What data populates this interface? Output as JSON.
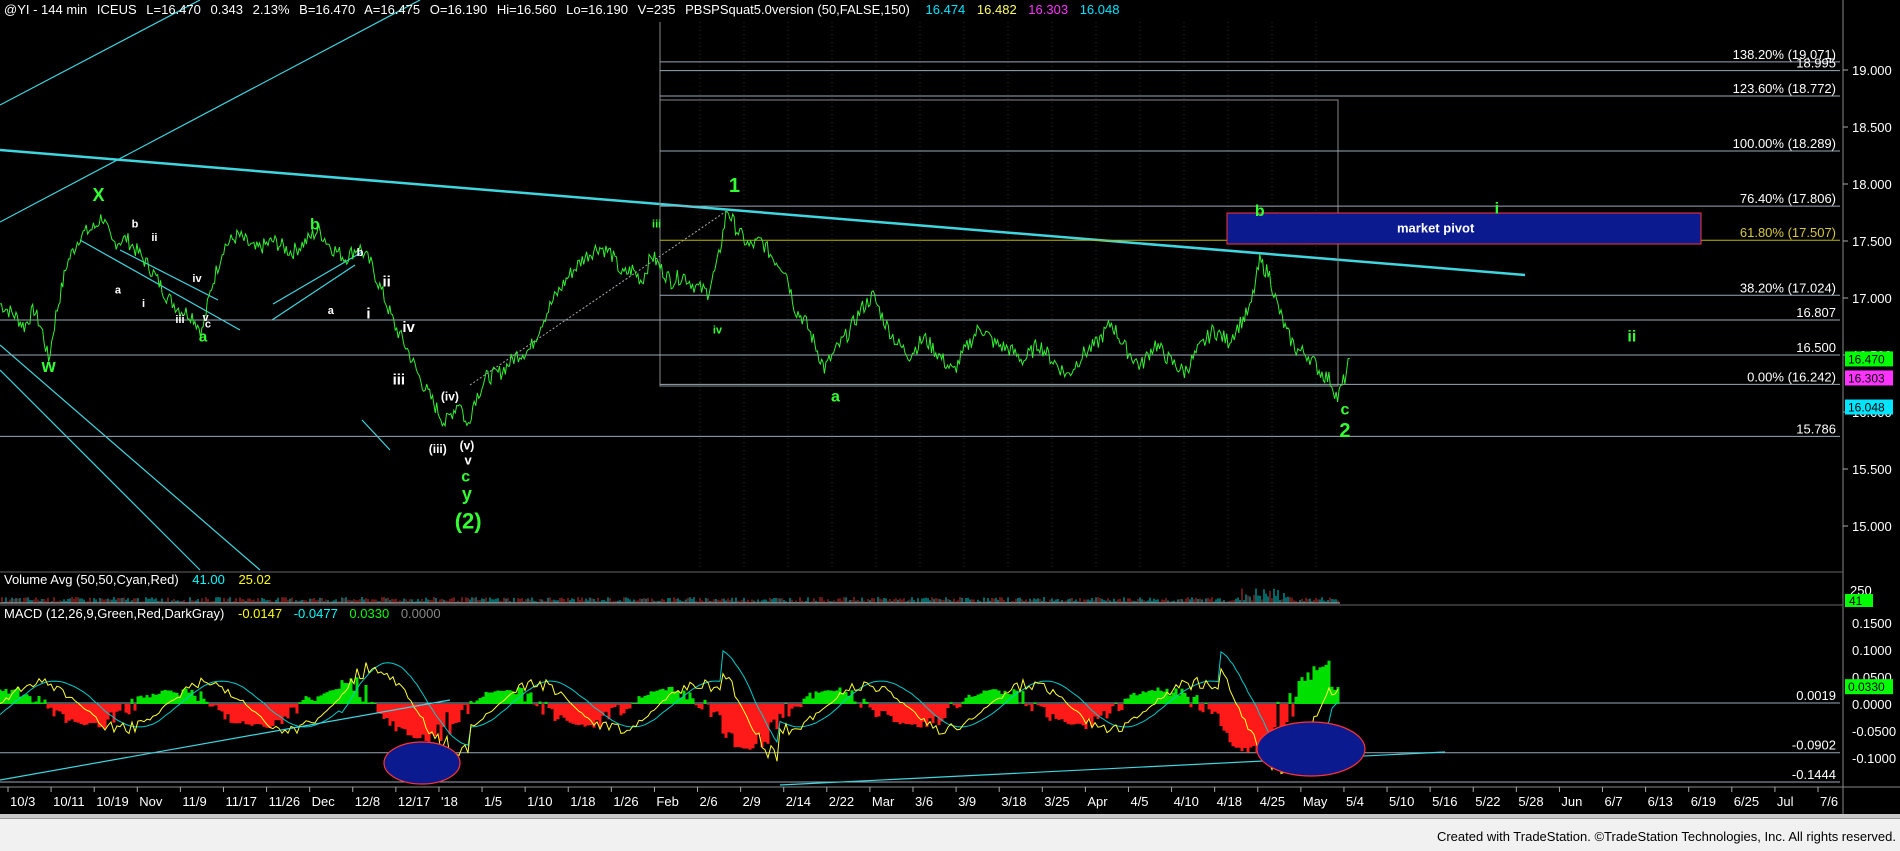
{
  "header": {
    "symbol": "@YI - 144 min",
    "exchange": "ICEUS",
    "last": "L=16.470",
    "change": "0.343",
    "change_pct": "2.13%",
    "bid": "B=16.470",
    "ask": "A=16.475",
    "open": "O=16.190",
    "high": "Hi=16.560",
    "low": "Lo=16.190",
    "volume": "V=235",
    "indicator": "PBSPSquat5.0version (50,FALSE,150)",
    "ind_values": [
      "16.474",
      "16.482",
      "16.303",
      "16.048"
    ],
    "ind_colors": [
      "#00e5ff",
      "#ffff66",
      "#ff33ff",
      "#00e5ff"
    ]
  },
  "volume_panel": {
    "label": "Volume Avg (50,50,Cyan,Red)",
    "values": [
      "41.00",
      "25.02"
    ],
    "value_colors": [
      "#00ffff",
      "#ffff00"
    ],
    "axis_tag": "41",
    "axis_tick": "250"
  },
  "macd_panel": {
    "label": "MACD (12,26,9,Green,Red,DarkGray)",
    "values": [
      "-0.0147",
      "-0.0477",
      "0.0330",
      "0.0000"
    ],
    "value_colors": [
      "#ffff00",
      "#00ffff",
      "#00ff00",
      "#888888"
    ],
    "axis_ticks": [
      "0.1500",
      "0.1000",
      "0.0500",
      "0.0000",
      "-0.0500",
      "-0.1000"
    ],
    "levels": [
      "0.0019",
      "-0.0902",
      "-0.1444"
    ],
    "current_tag": "0.0330"
  },
  "chart_data": {
    "type": "line",
    "price_axis": {
      "ticks": [
        "19.000",
        "18.500",
        "18.000",
        "17.500",
        "17.000",
        "16.500",
        "16.000",
        "15.500",
        "15.000"
      ],
      "ylim": [
        14.6,
        19.45
      ]
    },
    "date_labels": [
      "10/3",
      "10/11",
      "10/19",
      "Nov",
      "11/9",
      "11/17",
      "11/26",
      "Dec",
      "12/8",
      "12/17",
      "'18",
      "1/5",
      "1/10",
      "1/18",
      "1/26",
      "Feb",
      "2/6",
      "2/9",
      "2/14",
      "2/22",
      "Mar",
      "3/6",
      "3/9",
      "3/18",
      "3/25",
      "Apr",
      "4/5",
      "4/10",
      "4/18",
      "4/25",
      "May",
      "5/4",
      "5/10",
      "5/16",
      "5/22",
      "5/28",
      "Jun",
      "6/7",
      "6/13",
      "6/19",
      "6/25",
      "Jul",
      "7/6"
    ],
    "fib_levels": [
      {
        "label": "138.20% (19.071)",
        "value": 19.071
      },
      {
        "label": "18.995",
        "value": 18.995
      },
      {
        "label": "123.60% (18.772)",
        "value": 18.772
      },
      {
        "label": "100.00% (18.289)",
        "value": 18.289
      },
      {
        "label": "76.40% (17.806)",
        "value": 17.806
      },
      {
        "label": "61.80% (17.507)",
        "value": 17.507
      },
      {
        "label": "38.20% (17.024)",
        "value": 17.024
      },
      {
        "label": "16.807",
        "value": 16.807
      },
      {
        "label": "16.500",
        "value": 16.5
      },
      {
        "label": "0.00% (16.242)",
        "value": 16.242
      },
      {
        "label": "15.786",
        "value": 15.786
      }
    ],
    "price_tags": [
      {
        "label": "16.470",
        "value": 16.47,
        "bg": "#00ff00",
        "fg": "#000000"
      },
      {
        "label": "16.303",
        "value": 16.303,
        "bg": "#ff33ff",
        "fg": "#000000"
      },
      {
        "label": "16.048",
        "value": 16.048,
        "bg": "#00e5ff",
        "fg": "#000000"
      }
    ],
    "price_path": [
      [
        0,
        16.95
      ],
      [
        12,
        16.85
      ],
      [
        20,
        16.75
      ],
      [
        28,
        16.9
      ],
      [
        35,
        16.7
      ],
      [
        40,
        16.45
      ],
      [
        46,
        16.85
      ],
      [
        55,
        17.3
      ],
      [
        66,
        17.55
      ],
      [
        78,
        17.62
      ],
      [
        84,
        17.72
      ],
      [
        92,
        17.48
      ],
      [
        104,
        17.52
      ],
      [
        115,
        17.38
      ],
      [
        125,
        17.24
      ],
      [
        138,
        17.0
      ],
      [
        148,
        16.9
      ],
      [
        158,
        16.85
      ],
      [
        166,
        16.7
      ],
      [
        174,
        17.1
      ],
      [
        184,
        17.45
      ],
      [
        196,
        17.55
      ],
      [
        210,
        17.42
      ],
      [
        225,
        17.5
      ],
      [
        240,
        17.4
      ],
      [
        252,
        17.5
      ],
      [
        262,
        17.6
      ],
      [
        272,
        17.45
      ],
      [
        284,
        17.35
      ],
      [
        295,
        17.45
      ],
      [
        305,
        17.3
      ],
      [
        316,
        17.0
      ],
      [
        325,
        16.75
      ],
      [
        335,
        16.55
      ],
      [
        345,
        16.3
      ],
      [
        358,
        16.05
      ],
      [
        366,
        15.9
      ],
      [
        372,
        16.0
      ],
      [
        378,
        16.1
      ],
      [
        384,
        15.86
      ],
      [
        390,
        16.1
      ],
      [
        400,
        16.3
      ],
      [
        412,
        16.35
      ],
      [
        425,
        16.5
      ],
      [
        436,
        16.55
      ],
      [
        446,
        16.8
      ],
      [
        456,
        17.0
      ],
      [
        468,
        17.2
      ],
      [
        480,
        17.35
      ],
      [
        492,
        17.45
      ],
      [
        502,
        17.4
      ],
      [
        512,
        17.2
      ],
      [
        520,
        17.25
      ],
      [
        528,
        17.15
      ],
      [
        536,
        17.38
      ],
      [
        544,
        17.25
      ],
      [
        552,
        17.15
      ],
      [
        562,
        17.2
      ],
      [
        572,
        17.1
      ],
      [
        582,
        17.05
      ],
      [
        590,
        17.3
      ],
      [
        598,
        17.78
      ],
      [
        606,
        17.6
      ],
      [
        616,
        17.45
      ],
      [
        626,
        17.5
      ],
      [
        636,
        17.35
      ],
      [
        646,
        17.25
      ],
      [
        654,
        16.9
      ],
      [
        662,
        16.8
      ],
      [
        670,
        16.6
      ],
      [
        678,
        16.38
      ],
      [
        688,
        16.55
      ],
      [
        698,
        16.7
      ],
      [
        708,
        16.9
      ],
      [
        718,
        17.02
      ],
      [
        728,
        16.78
      ],
      [
        738,
        16.6
      ],
      [
        748,
        16.5
      ],
      [
        760,
        16.65
      ],
      [
        772,
        16.5
      ],
      [
        784,
        16.35
      ],
      [
        794,
        16.55
      ],
      [
        806,
        16.75
      ],
      [
        818,
        16.6
      ],
      [
        830,
        16.55
      ],
      [
        842,
        16.45
      ],
      [
        854,
        16.6
      ],
      [
        866,
        16.45
      ],
      [
        878,
        16.32
      ],
      [
        890,
        16.5
      ],
      [
        902,
        16.6
      ],
      [
        914,
        16.78
      ],
      [
        926,
        16.55
      ],
      [
        938,
        16.4
      ],
      [
        950,
        16.6
      ],
      [
        962,
        16.45
      ],
      [
        974,
        16.35
      ],
      [
        986,
        16.55
      ],
      [
        998,
        16.72
      ],
      [
        1010,
        16.62
      ],
      [
        1020,
        16.78
      ],
      [
        1028,
        16.9
      ],
      [
        1036,
        17.32
      ],
      [
        1044,
        17.2
      ],
      [
        1050,
        16.95
      ],
      [
        1058,
        16.7
      ],
      [
        1066,
        16.55
      ],
      [
        1076,
        16.5
      ],
      [
        1086,
        16.35
      ],
      [
        1094,
        16.28
      ],
      [
        1100,
        16.12
      ],
      [
        1106,
        16.3
      ],
      [
        1110,
        16.47
      ]
    ],
    "wave_labels": [
      {
        "t": "X",
        "x": 81,
        "v": 17.85,
        "c": "#33ff33",
        "s": 18
      },
      {
        "t": "w",
        "x": 40,
        "v": 16.35,
        "c": "#33ff33",
        "s": 18
      },
      {
        "t": "b",
        "x": 111,
        "v": 17.62,
        "c": "#ffffff",
        "s": 11
      },
      {
        "t": "ii",
        "x": 127,
        "v": 17.5,
        "c": "#ffffff",
        "s": 11
      },
      {
        "t": "a",
        "x": 97,
        "v": 17.04,
        "c": "#ffffff",
        "s": 11
      },
      {
        "t": "i",
        "x": 118,
        "v": 16.92,
        "c": "#ffffff",
        "s": 11
      },
      {
        "t": "iii",
        "x": 148,
        "v": 16.78,
        "c": "#ffffff",
        "s": 11
      },
      {
        "t": "iv",
        "x": 162,
        "v": 17.14,
        "c": "#ffffff",
        "s": 11
      },
      {
        "t": "v",
        "x": 169,
        "v": 16.8,
        "c": "#ffffff",
        "s": 11
      },
      {
        "t": "c",
        "x": 171,
        "v": 16.74,
        "c": "#ffffff",
        "s": 11
      },
      {
        "t": "a",
        "x": 167,
        "v": 16.62,
        "c": "#33ff33",
        "s": 15
      },
      {
        "t": "b",
        "x": 259,
        "v": 17.6,
        "c": "#33ff33",
        "s": 16
      },
      {
        "t": "a",
        "x": 272,
        "v": 16.86,
        "c": "#ffffff",
        "s": 11
      },
      {
        "t": "b",
        "x": 296,
        "v": 17.37,
        "c": "#ffffff",
        "s": 11
      },
      {
        "t": "i",
        "x": 303,
        "v": 16.82,
        "c": "#ffffff",
        "s": 15
      },
      {
        "t": "ii",
        "x": 318,
        "v": 17.1,
        "c": "#ffffff",
        "s": 15
      },
      {
        "t": "iv",
        "x": 336,
        "v": 16.7,
        "c": "#ffffff",
        "s": 15
      },
      {
        "t": "iii",
        "x": 328,
        "v": 16.24,
        "c": "#ffffff",
        "s": 15
      },
      {
        "t": "(iv)",
        "x": 370,
        "v": 16.1,
        "c": "#ffffff",
        "s": 12
      },
      {
        "t": "(iii)",
        "x": 360,
        "v": 15.64,
        "c": "#ffffff",
        "s": 12
      },
      {
        "t": "(v)",
        "x": 384,
        "v": 15.67,
        "c": "#ffffff",
        "s": 12
      },
      {
        "t": "v",
        "x": 385,
        "v": 15.54,
        "c": "#ffffff",
        "s": 13
      },
      {
        "t": "c",
        "x": 383,
        "v": 15.39,
        "c": "#33ff33",
        "s": 16
      },
      {
        "t": "y",
        "x": 384,
        "v": 15.23,
        "c": "#33ff33",
        "s": 18
      },
      {
        "t": "(2)",
        "x": 385,
        "v": 14.98,
        "c": "#33ff33",
        "s": 22
      },
      {
        "t": "iii",
        "x": 540,
        "v": 17.62,
        "c": "#33ff33",
        "s": 11
      },
      {
        "t": "iv",
        "x": 590,
        "v": 16.69,
        "c": "#33ff33",
        "s": 11
      },
      {
        "t": "1",
        "x": 604,
        "v": 17.93,
        "c": "#33ff33",
        "s": 20
      },
      {
        "t": "a",
        "x": 687,
        "v": 16.09,
        "c": "#33ff33",
        "s": 16
      },
      {
        "t": "b",
        "x": 1036,
        "v": 17.72,
        "c": "#33ff33",
        "s": 16
      },
      {
        "t": "c",
        "x": 1106,
        "v": 15.98,
        "c": "#33ff33",
        "s": 16
      },
      {
        "t": "2",
        "x": 1106,
        "v": 15.78,
        "c": "#33ff33",
        "s": 20
      },
      {
        "t": "i",
        "x": 1231,
        "v": 17.74,
        "c": "#33ff33",
        "s": 16
      },
      {
        "t": "ii",
        "x": 1342,
        "v": 16.62,
        "c": "#33ff33",
        "s": 16
      }
    ],
    "annotation": "market pivot"
  },
  "footer": "Created with TradeStation. ©TradeStation Technologies, Inc. All rights reserved."
}
